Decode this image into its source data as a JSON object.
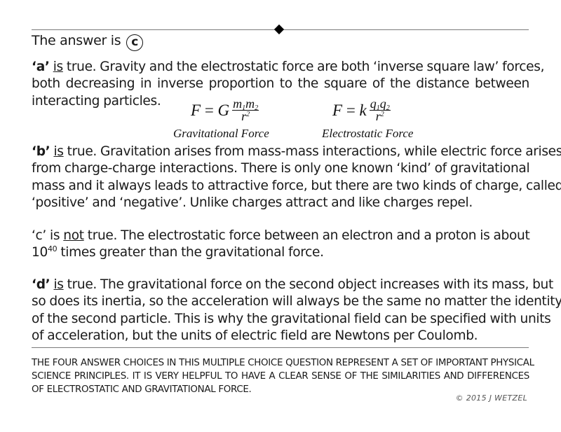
{
  "header": {
    "answer_prefix": "The answer is",
    "answer_letter": "c"
  },
  "paragraphs": {
    "a": {
      "label": "‘a’",
      "verdict_word": "is",
      "lines": [
        " true.  Gravity and the electrostatic force are both ‘inverse square law’ forces,",
        "both decreasing  in inverse proportion to the square of the distance between",
        "interacting particles."
      ]
    },
    "b": {
      "label": "‘b’",
      "verdict_word": "is",
      "lines": [
        " true.  Gravitation arises from mass-mass interactions, while electric force arises",
        "from charge-charge interactions.  There is only one known ‘kind’ of gravitational",
        "mass and it always leads to attractive force, but there are two kinds of charge, called",
        "‘positive’ and ‘negative’.  Unlike charges attract and like charges repel."
      ]
    },
    "c": {
      "label": "‘c’ is ",
      "verdict_word": "not",
      "line1_rest": " true.  The electrostatic force between an electron and a proton is about",
      "line2_base": "10",
      "line2_exp": "40",
      "line2_rest": " times greater than the gravitational force."
    },
    "d": {
      "label": "‘d’",
      "verdict_word": "is",
      "lines": [
        " true.  The gravitational force on the second object increases with its mass, but",
        "so does its inertia, so the acceleration will always be the same no matter the identity",
        "of the second particle.  This is why the gravitational field can be specified with units",
        "of acceleration, but the units of electric field are Newtons per Coulomb."
      ]
    }
  },
  "formulas": {
    "gravitational": {
      "lhs": "F",
      "eq": "=",
      "const": "G",
      "num_a": "m",
      "num_a_sub": "1",
      "num_b": "m",
      "num_b_sub": "2",
      "den": "r",
      "den_exp": "2",
      "label": "Gravitational Force"
    },
    "electrostatic": {
      "lhs": "F",
      "eq": "=",
      "const": "k",
      "num_a": "q",
      "num_a_sub": "1",
      "num_b": "q",
      "num_b_sub": "2",
      "den": "r",
      "den_exp": "2",
      "label": "Electrostatic Force"
    }
  },
  "footer": {
    "lines": [
      "THE FOUR ANSWER CHOICES IN THIS MULTIPLE CHOICE QUESTION REPRESENT A SET OF IMPORTANT PHYSICAL",
      "SCIENCE PRINCIPLES.  IT IS VERY HELPFUL TO HAVE A CLEAR SENSE OF THE SIMILARITIES AND DIFFERENCES",
      "OF ELECTROSTATIC AND GRAVITATIONAL FORCE."
    ],
    "copyright": "© 2015 J WETZEL"
  }
}
